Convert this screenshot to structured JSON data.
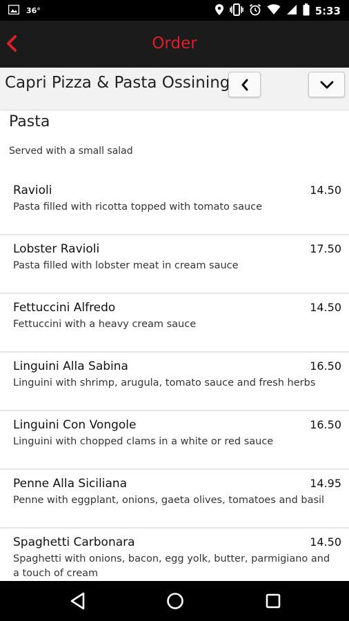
{
  "status_bar": {
    "temperature": "36°",
    "time": "5:33",
    "icons": [
      "image-icon",
      "location-icon",
      "vibrate-icon",
      "alarm-icon",
      "wifi-icon",
      "signal-icon",
      "battery-icon"
    ]
  },
  "app_bar": {
    "title": "Order",
    "back_icon": "chevron-left-icon",
    "accent_color": "#d9212b"
  },
  "restaurant_bar": {
    "name": "Capri Pizza & Pasta Ossining",
    "prev_icon": "chevron-left-icon",
    "dropdown_icon": "chevron-down-icon"
  },
  "category": {
    "title": "Pasta",
    "description": "Served with a small salad"
  },
  "menu_items": [
    {
      "name": "Ravioli",
      "price": "14.50",
      "description": "Pasta filled with ricotta topped with tomato sauce"
    },
    {
      "name": "Lobster Ravioli",
      "price": "17.50",
      "description": "Pasta filled with lobster meat in cream sauce"
    },
    {
      "name": "Fettuccini Alfredo",
      "price": "14.50",
      "description": "Fettuccini with a heavy cream sauce"
    },
    {
      "name": "Linguini Alla Sabina",
      "price": "16.50",
      "description": "Linguini with shrimp, arugula, tomato sauce and fresh herbs"
    },
    {
      "name": "Linguini Con Vongole",
      "price": "16.50",
      "description": "Linguini with chopped clams in a white or red sauce"
    },
    {
      "name": "Penne Alla Siciliana",
      "price": "14.95",
      "description": "Penne with eggplant, onions, gaeta olives, tomatoes and basil"
    },
    {
      "name": "Spaghetti Carbonara",
      "price": "14.50",
      "description": "Spaghetti with onions, bacon, egg yolk, butter, parmigiano and a touch of cream"
    }
  ],
  "nav_bar": {
    "icons": [
      "back-triangle-icon",
      "home-circle-icon",
      "recent-apps-icon"
    ]
  }
}
